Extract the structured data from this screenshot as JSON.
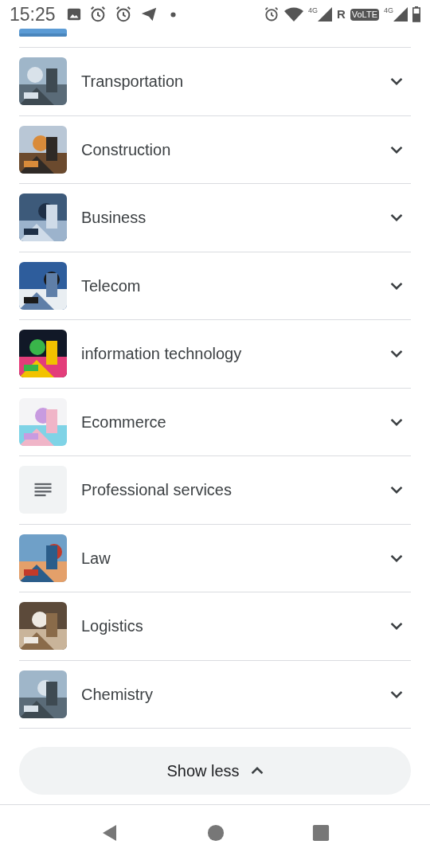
{
  "status_bar": {
    "time": "15:25",
    "network_1": "4G",
    "roaming": "R",
    "volte": "VoLTE",
    "network_2": "4G"
  },
  "items": [
    {
      "label": "Transportation",
      "kind": "picture"
    },
    {
      "label": "Construction",
      "kind": "picture"
    },
    {
      "label": "Business",
      "kind": "picture"
    },
    {
      "label": "Telecom",
      "kind": "picture"
    },
    {
      "label": "information technology",
      "kind": "picture"
    },
    {
      "label": "Ecommerce",
      "kind": "picture"
    },
    {
      "label": "Professional services",
      "kind": "icon"
    },
    {
      "label": "Law",
      "kind": "picture"
    },
    {
      "label": "Logistics",
      "kind": "picture"
    },
    {
      "label": "Chemistry",
      "kind": "picture"
    }
  ],
  "show_less": {
    "label": "Show less"
  }
}
